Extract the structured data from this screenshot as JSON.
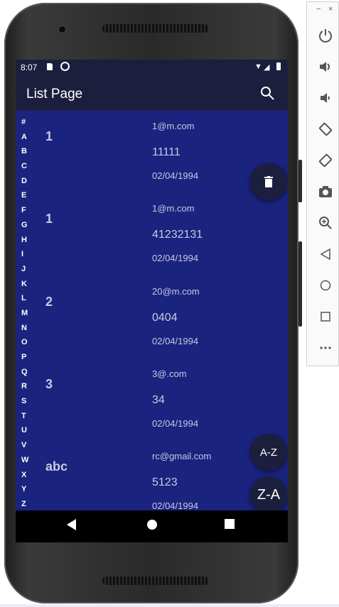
{
  "status_bar": {
    "time": "8:07"
  },
  "app_bar": {
    "title": "List Page",
    "search_icon": "search-icon"
  },
  "index_letters": [
    "#",
    "A",
    "B",
    "C",
    "D",
    "E",
    "F",
    "G",
    "H",
    "I",
    "J",
    "K",
    "L",
    "M",
    "N",
    "O",
    "P",
    "Q",
    "R",
    "S",
    "T",
    "U",
    "V",
    "W",
    "X",
    "Y",
    "Z"
  ],
  "contacts": [
    {
      "name": "1",
      "email": "1@m.com",
      "phone": "11111",
      "date": "02/04/1994"
    },
    {
      "name": "1",
      "email": "1@m.com",
      "phone": "41232131",
      "date": "02/04/1994"
    },
    {
      "name": "2",
      "email": "20@m.com",
      "phone": "0404",
      "date": "02/04/1994"
    },
    {
      "name": "3",
      "email": "3@.com",
      "phone": "34",
      "date": "02/04/1994"
    },
    {
      "name": "abc",
      "email": "rc@gmail.com",
      "phone": "5123",
      "date": "02/04/1994"
    }
  ],
  "fabs": {
    "delete_icon": "trash-icon",
    "sort_az": "A-Z",
    "sort_za": "Z-A",
    "add": "+"
  },
  "colors": {
    "list_bg": "#1a237e",
    "appbar_bg": "#1b1f3d",
    "add_accent": "#7ed321"
  },
  "emulator": {
    "minimize": "−",
    "close": "×"
  }
}
